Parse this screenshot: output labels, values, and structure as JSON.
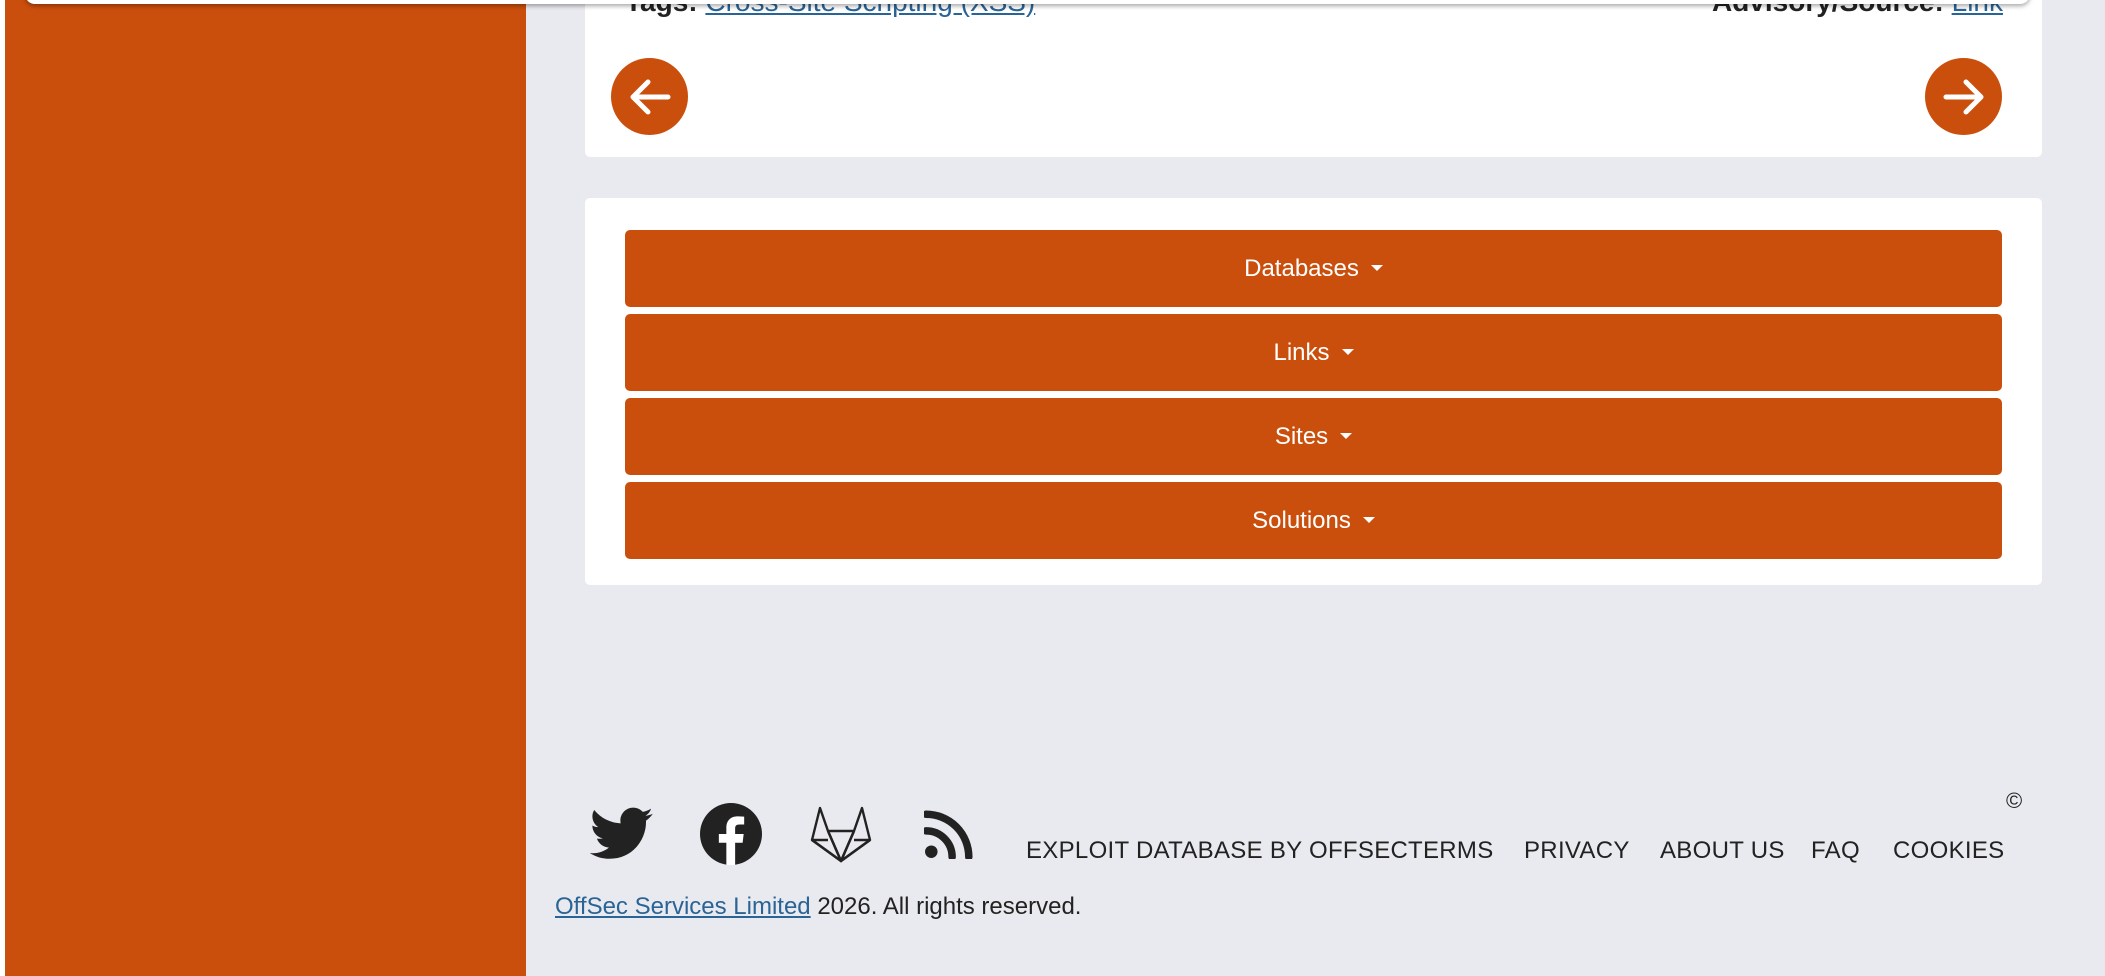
{
  "colors": {
    "accent": "#cb4f0c",
    "page_bg": "#e9eaef",
    "link": "#2a6496",
    "card_bg": "#ffffff"
  },
  "exploit_card": {
    "tags_label": "Tags:",
    "tags_value": "Cross-Site Scripting (XSS)",
    "advisory_label": "Advisory/Source:",
    "advisory_value": "Link",
    "prev_icon": "arrow-left-icon",
    "next_icon": "arrow-right-icon"
  },
  "menu": {
    "items": [
      {
        "label": "Databases"
      },
      {
        "label": "Links"
      },
      {
        "label": "Sites"
      },
      {
        "label": "Solutions"
      }
    ]
  },
  "footer": {
    "social_icons": [
      "twitter-icon",
      "facebook-icon",
      "gitlab-icon",
      "rss-icon"
    ],
    "links": [
      {
        "label": "EXPLOIT DATABASE BY OFFSEC"
      },
      {
        "label": "TERMS"
      },
      {
        "label": "PRIVACY"
      },
      {
        "label": "ABOUT US"
      },
      {
        "label": "FAQ"
      },
      {
        "label": "COOKIES"
      }
    ],
    "copyright_symbol": "©",
    "company": "OffSec Services Limited",
    "rights": "2026. All rights reserved."
  }
}
